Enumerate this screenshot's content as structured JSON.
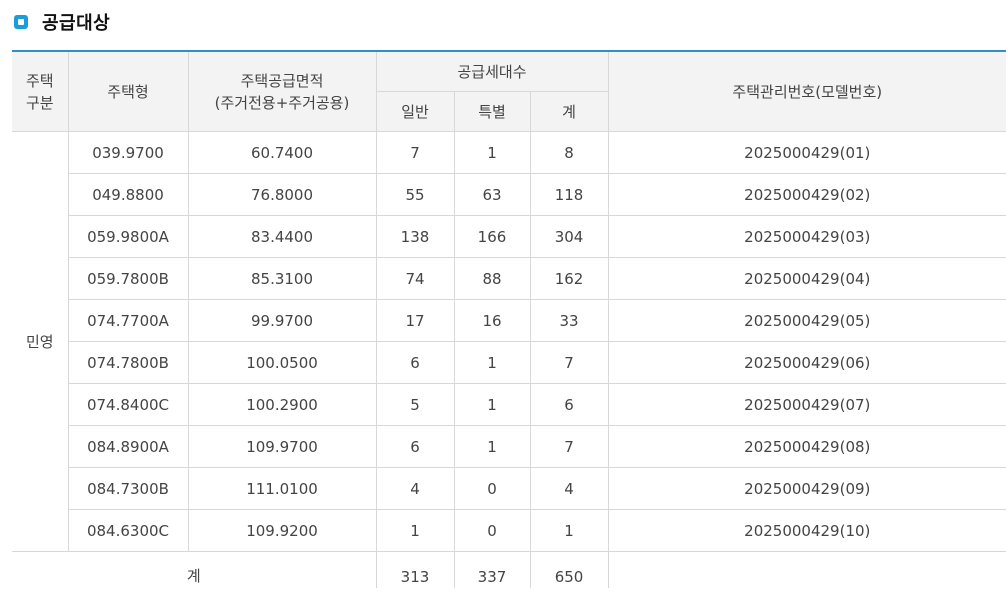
{
  "section": {
    "title": "공급대상"
  },
  "headers": {
    "type_group": [
      "주택",
      "구분"
    ],
    "model": "주택형",
    "area": [
      "주택공급면적",
      "(주거전용+주거공용)"
    ],
    "households": "공급세대수",
    "general": "일반",
    "special": "특별",
    "total": "계",
    "mgmt_no": "주택관리번호(모델번호)"
  },
  "category": "민영",
  "rows": [
    {
      "model": "039.9700",
      "area": "60.7400",
      "general": "7",
      "special": "1",
      "total": "8",
      "id": "2025000429(01)"
    },
    {
      "model": "049.8800",
      "area": "76.8000",
      "general": "55",
      "special": "63",
      "total": "118",
      "id": "2025000429(02)"
    },
    {
      "model": "059.9800A",
      "area": "83.4400",
      "general": "138",
      "special": "166",
      "total": "304",
      "id": "2025000429(03)"
    },
    {
      "model": "059.7800B",
      "area": "85.3100",
      "general": "74",
      "special": "88",
      "total": "162",
      "id": "2025000429(04)"
    },
    {
      "model": "074.7700A",
      "area": "99.9700",
      "general": "17",
      "special": "16",
      "total": "33",
      "id": "2025000429(05)"
    },
    {
      "model": "074.7800B",
      "area": "100.0500",
      "general": "6",
      "special": "1",
      "total": "7",
      "id": "2025000429(06)"
    },
    {
      "model": "074.8400C",
      "area": "100.2900",
      "general": "5",
      "special": "1",
      "total": "6",
      "id": "2025000429(07)"
    },
    {
      "model": "084.8900A",
      "area": "109.9700",
      "general": "6",
      "special": "1",
      "total": "7",
      "id": "2025000429(08)"
    },
    {
      "model": "084.7300B",
      "area": "111.0100",
      "general": "4",
      "special": "0",
      "total": "4",
      "id": "2025000429(09)"
    },
    {
      "model": "084.6300C",
      "area": "109.9200",
      "general": "1",
      "special": "0",
      "total": "1",
      "id": "2025000429(10)"
    }
  ],
  "totals": {
    "label": "계",
    "general": "313",
    "special": "337",
    "total": "650"
  }
}
